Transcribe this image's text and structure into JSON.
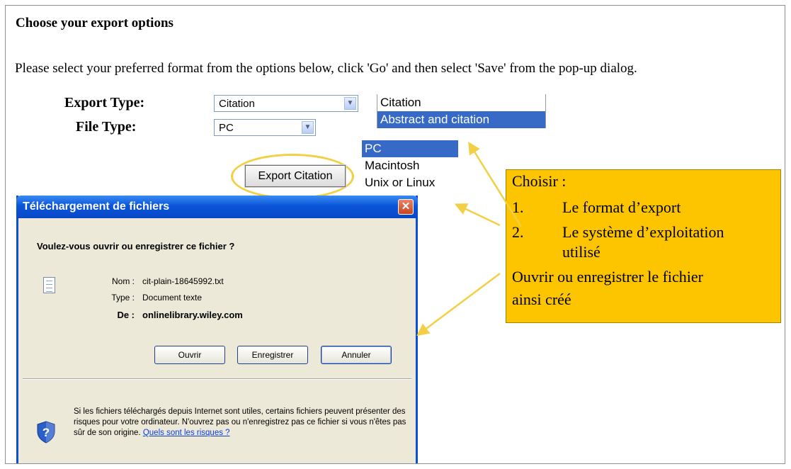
{
  "page": {
    "heading": "Choose your export options",
    "intro": "Please select your preferred format from the options below, click 'Go' and then select 'Save' from the pop-up dialog."
  },
  "form": {
    "export_type_label": "Export Type:",
    "export_type_value": "Citation",
    "export_type_options": [
      "Citation",
      "Abstract and citation"
    ],
    "export_type_highlighted": "Abstract and citation",
    "file_type_label": "File Type:",
    "file_type_value": "PC",
    "file_type_options": [
      "PC",
      "Macintosh",
      "Unix or Linux"
    ],
    "file_type_highlighted": "PC",
    "export_button": "Export Citation"
  },
  "dialog": {
    "title": "Téléchargement de fichiers",
    "close_glyph": "✕",
    "question": "Voulez-vous ouvrir ou enregistrer ce fichier ?",
    "name_label": "Nom :",
    "name_value": "cit-plain-18645992.txt",
    "type_label": "Type :",
    "type_value": "Document texte",
    "from_label": "De :",
    "from_value": "onlinelibrary.wiley.com",
    "btn_open": "Ouvrir",
    "btn_save": "Enregistrer",
    "btn_cancel": "Annuler",
    "warning": "Si les fichiers téléchargés depuis Internet sont utiles, certains fichiers peuvent présenter des risques pour votre ordinateur. N'ouvrez pas ou n'enregistrez pas ce fichier si vous n'êtes pas sûr de son origine.",
    "warning_link": "Quels sont les risques ?"
  },
  "callout": {
    "title": "Choisir :",
    "item1_num": "1.",
    "item1_text": "Le format d’export",
    "item2_num": "2.",
    "item2_text_a": "Le système d’exploitation",
    "item2_text_b": "utilisé",
    "line3": "Ouvrir ou enregistrer le fichier",
    "line4": "ainsi créé"
  },
  "colors": {
    "callout_bg": "#fdc500",
    "highlight": "#f3cf45",
    "selection": "#3769c7",
    "dialog_title": "#0a55d9"
  }
}
